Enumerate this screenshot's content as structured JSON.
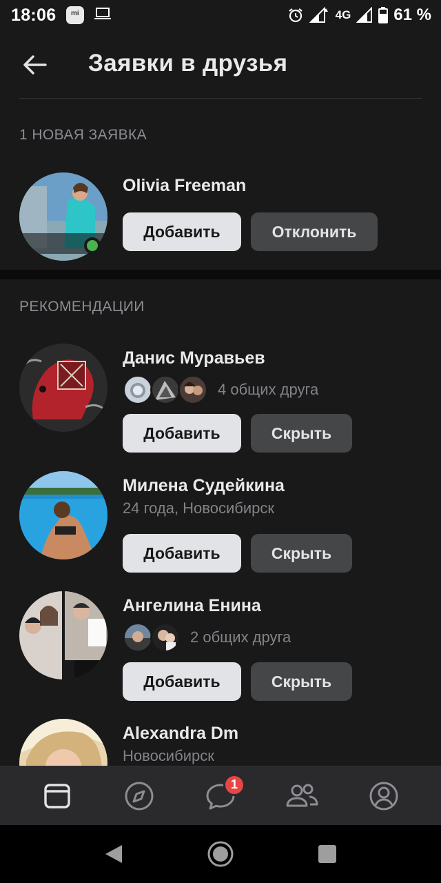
{
  "status_bar": {
    "time": "18:06",
    "network": "4G",
    "battery": "61 %"
  },
  "header": {
    "title": "Заявки в друзья"
  },
  "requests_section": {
    "title": "1 НОВАЯ ЗАЯВКА",
    "items": [
      {
        "name": "Olivia Freeman",
        "online": true,
        "accept_label": "Добавить",
        "decline_label": "Отклонить"
      }
    ]
  },
  "recommendations_section": {
    "title": "РЕКОМЕНДАЦИИ",
    "items": [
      {
        "name": "Данис Муравьев",
        "mutual_text": "4 общих друга",
        "add_label": "Добавить",
        "hide_label": "Скрыть"
      },
      {
        "name": "Милена Судейкина",
        "subtitle": "24 года, Новосибирск",
        "add_label": "Добавить",
        "hide_label": "Скрыть"
      },
      {
        "name": "Ангелина Енина",
        "mutual_text": "2 общих друга",
        "add_label": "Добавить",
        "hide_label": "Скрыть"
      },
      {
        "name": "Alexandra Dm",
        "subtitle": "Новосибирск"
      }
    ]
  },
  "tab_bar": {
    "tabs": [
      {
        "icon": "news-icon",
        "active": true
      },
      {
        "icon": "compass-icon"
      },
      {
        "icon": "messages-icon",
        "badge": "1"
      },
      {
        "icon": "friends-icon"
      },
      {
        "icon": "profile-icon"
      }
    ]
  },
  "colors": {
    "background": "#19191a",
    "primary_button": "#e1e3e6",
    "secondary_button": "#454647",
    "online": "#4bb34b",
    "badge": "#e64646"
  }
}
